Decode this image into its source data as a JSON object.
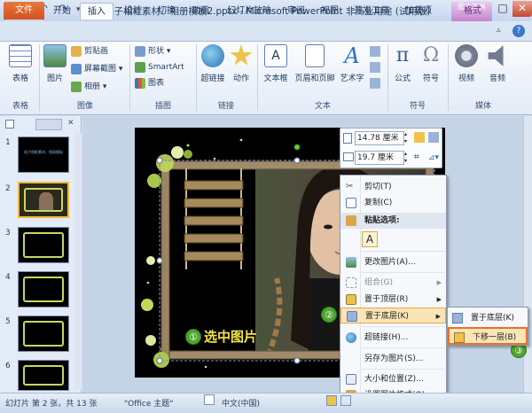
{
  "window": {
    "title": "电子相框素材、相册模板2.pptx - Microsoft PowerPoint 非商业用途 (试用版)",
    "controls": [
      "?",
      "—",
      "□",
      "✕"
    ]
  },
  "ribbon_tabs": [
    "文件",
    "开始",
    "插入",
    "设计",
    "切换",
    "动画",
    "幻灯片放映",
    "审阅",
    "视图",
    "开发工具",
    "加载项",
    "格式"
  ],
  "picture_tools_label": "图片工具",
  "ribbon": {
    "table": {
      "btn": "表格",
      "group": "表格"
    },
    "image": {
      "picture": "图片",
      "clipart": "剪贴画",
      "screenshot": "屏幕截图",
      "album": "相册",
      "group": "图像"
    },
    "illustration": {
      "shapes": "形状",
      "smartart": "SmartArt",
      "chart": "图表",
      "group": "插图"
    },
    "links": {
      "hyperlink": "超链接",
      "action": "动作",
      "group": "链接"
    },
    "text": {
      "textbox": "文本框",
      "header_footer": "页眉和页脚",
      "wordart": "艺术字",
      "group": "文本"
    },
    "symbols": {
      "equation": "公式",
      "symbol": "符号",
      "group": "符号"
    },
    "media": {
      "video": "视频",
      "audio": "音频",
      "group": "媒体"
    }
  },
  "slides_panel": {
    "numbers": [
      "1",
      "2",
      "3",
      "4",
      "5",
      "6"
    ],
    "slide1_caption": "电子相框素材、相册模板"
  },
  "mini_toolbar": {
    "height_value": "14.78 厘米",
    "width_value": "19.7 厘米"
  },
  "context_menu": {
    "items": [
      {
        "label": "剪切(T)",
        "icon": "scissors-icon",
        "state": "normal"
      },
      {
        "label": "复制(C)",
        "icon": "copy-icon",
        "state": "normal"
      },
      {
        "label": "粘贴选项:",
        "icon": "paste-icon",
        "state": "header"
      },
      {
        "label": "更改图片(A)...",
        "icon": "picture-icon",
        "state": "normal"
      },
      {
        "label": "组合(G)",
        "icon": "group-icon",
        "state": "disabled"
      },
      {
        "label": "置于顶层(R)",
        "icon": "bring-front-icon",
        "state": "normal"
      },
      {
        "label": "置于底层(K)",
        "icon": "send-back-icon",
        "state": "highlighted"
      },
      {
        "label": "超链接(H)...",
        "icon": "hyperlink-icon",
        "state": "normal"
      },
      {
        "label": "另存为图片(S)...",
        "icon": "",
        "state": "normal"
      },
      {
        "label": "大小和位置(Z)...",
        "icon": "size-icon",
        "state": "normal"
      },
      {
        "label": "设置图片格式(O)...",
        "icon": "format-icon",
        "state": "normal"
      }
    ],
    "paste_glyph": "A"
  },
  "submenu": {
    "items": [
      "置于底层(K)",
      "下移一层(B)"
    ]
  },
  "annotations": {
    "step1": "①",
    "step1_text": "选中图片",
    "step2": "②",
    "step3": "③"
  },
  "status_bar": {
    "slide_info": "幻灯片 第 2 张，共 13 张",
    "theme": "\"Office 主题\"",
    "language": "中文(中国)"
  },
  "colors": {
    "file_tab": "#d2521f",
    "highlight": "#fbe5b6",
    "step_badge": "#4fa52f",
    "frame_green": "#c8d760"
  }
}
